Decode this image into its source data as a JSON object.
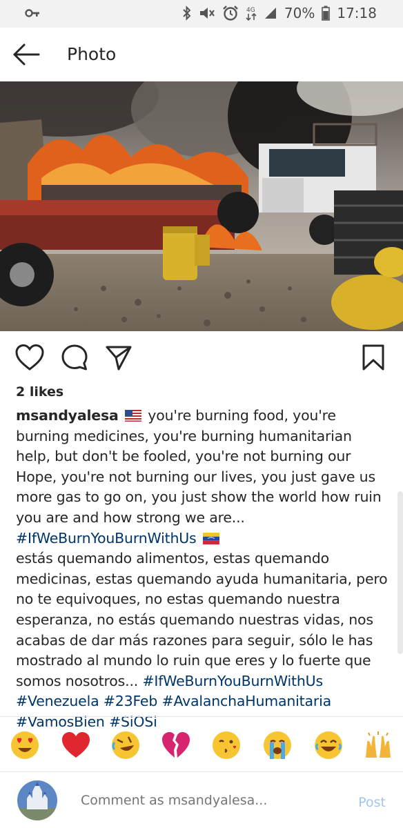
{
  "status_bar": {
    "battery": "70%",
    "time": "17:18",
    "icons": [
      "key-icon",
      "bluetooth-icon",
      "mute-icon",
      "alarm-icon",
      "4g-icon",
      "signal-icon",
      "battery-icon"
    ]
  },
  "header": {
    "title": "Photo"
  },
  "post": {
    "likes": "2 likes",
    "username": "msandyalesa",
    "caption_en": "you're burning food, you're burning medicines, you're burning humanitarian help, but don't be fooled, you're not burning our Hope, you're not burning our lives, you just gave us more gas to go on, you just show the world how ruin you are and how strong we are...",
    "tag1": "#IfWeBurnYouBurnWithUs",
    "caption_es": "estás quemando alimentos, estas quemando medicinas, estas quemando ayuda humanitaria, pero no te equivoques, no estas quemando nuestra esperanza, no estás quemando nuestras vidas, nos acabas de dar más razones para seguir, sólo le has mostrado al mundo lo ruin que eres y lo fuerte que somos nosotros...",
    "tags": [
      "#IfWeBurnYouBurnWithUs",
      "#Venezuela",
      "#23Feb",
      "#AvalanchaHumanitaria",
      "#VamosBien",
      "#SiOSi"
    ]
  },
  "emoji_bar": [
    "heart-eyes",
    "red-heart",
    "rolling-laughing",
    "broken-heart",
    "kissing-wink",
    "loudly-crying",
    "tears-of-joy",
    "raising-hands"
  ],
  "comment": {
    "placeholder": "Comment as msandyalesa...",
    "post_label": "Post"
  },
  "colors": {
    "hashtag": "#003569",
    "post_button": "#9fc6ef",
    "status_bar_bg": "#f2f2f2"
  }
}
